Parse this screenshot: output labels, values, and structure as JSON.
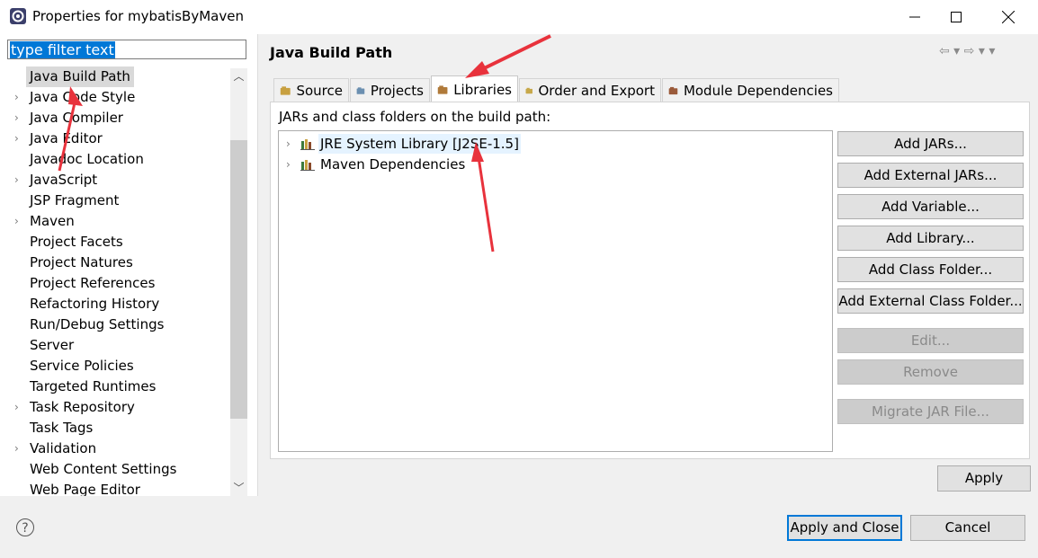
{
  "window": {
    "title": "Properties for mybatisByMaven",
    "minimize_icon": "minimize-icon",
    "maximize_icon": "maximize-icon",
    "close_icon": "close-icon"
  },
  "filter": {
    "text": "type filter text"
  },
  "nav": {
    "items": [
      {
        "label": "Java Build Path",
        "expandable": false,
        "selected": true
      },
      {
        "label": "Java Code Style",
        "expandable": true
      },
      {
        "label": "Java Compiler",
        "expandable": true
      },
      {
        "label": "Java Editor",
        "expandable": true
      },
      {
        "label": "Javadoc Location",
        "expandable": false
      },
      {
        "label": "JavaScript",
        "expandable": true
      },
      {
        "label": "JSP Fragment",
        "expandable": false
      },
      {
        "label": "Maven",
        "expandable": true
      },
      {
        "label": "Project Facets",
        "expandable": false
      },
      {
        "label": "Project Natures",
        "expandable": false
      },
      {
        "label": "Project References",
        "expandable": false
      },
      {
        "label": "Refactoring History",
        "expandable": false
      },
      {
        "label": "Run/Debug Settings",
        "expandable": false
      },
      {
        "label": "Server",
        "expandable": false
      },
      {
        "label": "Service Policies",
        "expandable": false
      },
      {
        "label": "Targeted Runtimes",
        "expandable": false
      },
      {
        "label": "Task Repository",
        "expandable": true
      },
      {
        "label": "Task Tags",
        "expandable": false
      },
      {
        "label": "Validation",
        "expandable": true
      },
      {
        "label": "Web Content Settings",
        "expandable": false
      },
      {
        "label": "Web Page Editor",
        "expandable": false
      }
    ]
  },
  "page": {
    "title": "Java Build Path",
    "history": "⇦ ▾ ⇨ ▾ ▾"
  },
  "tabs": [
    {
      "label": "Source",
      "icon": "source-icon"
    },
    {
      "label": "Projects",
      "icon": "projects-icon"
    },
    {
      "label": "Libraries",
      "icon": "libraries-icon",
      "active": true
    },
    {
      "label": "Order and Export",
      "icon": "order-export-icon"
    },
    {
      "label": "Module Dependencies",
      "icon": "module-dependencies-icon"
    }
  ],
  "libraries": {
    "heading": "JARs and class folders on the build path:",
    "entries": [
      {
        "label": "JRE System Library [J2SE-1.5]",
        "selected": true
      },
      {
        "label": "Maven Dependencies"
      }
    ]
  },
  "buttons": {
    "add_jars": "Add JARs...",
    "add_external_jars": "Add External JARs...",
    "add_variable": "Add Variable...",
    "add_library": "Add Library...",
    "add_class_folder": "Add Class Folder...",
    "add_external_class_folder": "Add External Class Folder...",
    "edit": "Edit...",
    "remove": "Remove",
    "migrate_jar": "Migrate JAR File...",
    "apply": "Apply",
    "apply_and_close": "Apply and Close",
    "cancel": "Cancel"
  },
  "colors": {
    "annotation_arrow": "#e8323c",
    "selection": "#0078d7"
  }
}
